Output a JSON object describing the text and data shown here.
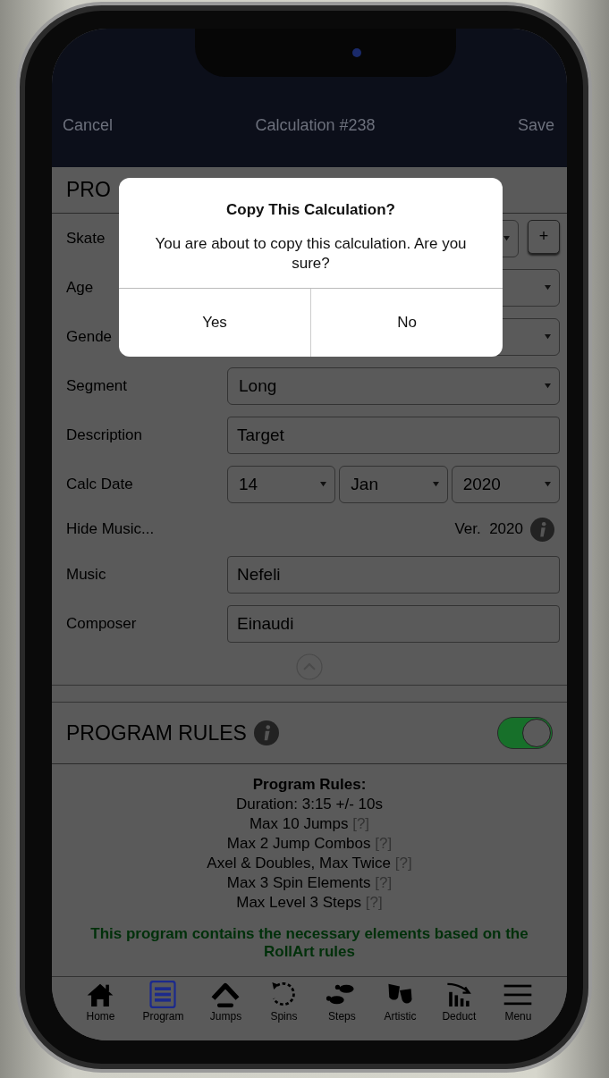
{
  "header": {
    "cancel": "Cancel",
    "title": "Calculation #238",
    "save": "Save"
  },
  "program_section": {
    "title": "PRO",
    "fields": [
      {
        "kind": "select-plus",
        "label": "Skate",
        "plus": "+"
      },
      {
        "kind": "select",
        "label": "Age"
      },
      {
        "kind": "select",
        "label": "Gende"
      },
      {
        "kind": "select",
        "label": "Segment",
        "value": "Long"
      },
      {
        "kind": "text",
        "label": "Description",
        "value": "Target"
      },
      {
        "kind": "date",
        "label": "Calc Date",
        "parts": [
          "14",
          "Jan",
          "2020"
        ]
      },
      {
        "kind": "info-line",
        "label": "Hide Music...",
        "version_label": "Ver.",
        "version": "2020"
      },
      {
        "kind": "text",
        "label": "Music",
        "value": "Nefeli"
      },
      {
        "kind": "text",
        "label": "Composer",
        "value": "Einaudi"
      }
    ]
  },
  "rules_section": {
    "title": "PROGRAM RULES",
    "enabled": true,
    "heading": "Program Rules:",
    "lines": [
      {
        "text": "Duration: 3:15 +/- 10s"
      },
      {
        "text": "Max 10 Jumps",
        "help": "[?]"
      },
      {
        "text": "Max 2 Jump Combos",
        "help": "[?]"
      },
      {
        "text": "Axel & Doubles, Max Twice",
        "help": "[?]"
      },
      {
        "text": "Max 3 Spin Elements",
        "help": "[?]"
      },
      {
        "text": "Max Level 3 Steps",
        "help": "[?]"
      }
    ],
    "message": "This program contains the necessary elements based on the RollArt rules"
  },
  "nav": [
    {
      "label": "Home",
      "selected": false
    },
    {
      "label": "Program",
      "selected": true
    },
    {
      "label": "Jumps",
      "selected": false
    },
    {
      "label": "Spins",
      "selected": false
    },
    {
      "label": "Steps",
      "selected": false
    },
    {
      "label": "Artistic",
      "selected": false
    },
    {
      "label": "Deduct",
      "selected": false
    },
    {
      "label": "Menu",
      "selected": false
    }
  ],
  "dialog": {
    "title": "Copy This Calculation?",
    "message": "You are about to copy this calculation. Are you sure?",
    "buttons": [
      "Yes",
      "No"
    ]
  }
}
